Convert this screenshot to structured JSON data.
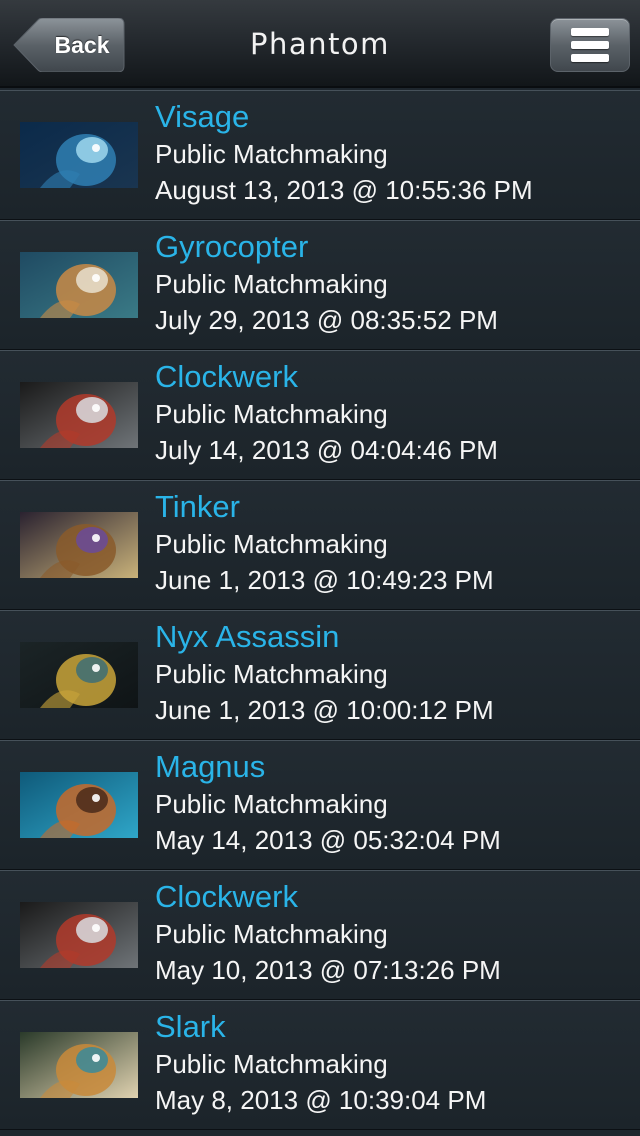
{
  "navbar": {
    "back_label": "Back",
    "title": "Phantom",
    "menu_icon": "hamburger-menu-icon"
  },
  "matches": [
    {
      "hero": "Visage",
      "lobby": "Public Matchmaking",
      "date": "August 13, 2013 @ 10:55:36 PM",
      "portrait": "visage-portrait",
      "palette": [
        "#0b2a4a",
        "#2f7fb3",
        "#9fd8ef",
        "#1a3550"
      ]
    },
    {
      "hero": "Gyrocopter",
      "lobby": "Public Matchmaking",
      "date": "July 29, 2013 @ 08:35:52 PM",
      "portrait": "gyrocopter-portrait",
      "palette": [
        "#1f4a62",
        "#c98a45",
        "#e9e0cf",
        "#3a7a86"
      ]
    },
    {
      "hero": "Clockwerk",
      "lobby": "Public Matchmaking",
      "date": "July 14, 2013 @ 04:04:46 PM",
      "portrait": "clockwerk-portrait",
      "palette": [
        "#1a1a1a",
        "#b23a2a",
        "#d9dde0",
        "#6f7478"
      ]
    },
    {
      "hero": "Tinker",
      "lobby": "Public Matchmaking",
      "date": "June 1, 2013 @ 10:49:23 PM",
      "portrait": "tinker-portrait",
      "palette": [
        "#2a2230",
        "#8a5a2a",
        "#6a4a9a",
        "#c9b27a"
      ]
    },
    {
      "hero": "Nyx Assassin",
      "lobby": "Public Matchmaking",
      "date": "June 1, 2013 @ 10:00:12 PM",
      "portrait": "nyx-assassin-portrait",
      "palette": [
        "#1b2426",
        "#c9a53a",
        "#3d6f75",
        "#0f1416"
      ]
    },
    {
      "hero": "Magnus",
      "lobby": "Public Matchmaking",
      "date": "May 14, 2013 @ 05:32:04 PM",
      "portrait": "magnus-portrait",
      "palette": [
        "#0f5a7a",
        "#c76a2a",
        "#4a2a1a",
        "#2fa6c8"
      ]
    },
    {
      "hero": "Clockwerk",
      "lobby": "Public Matchmaking",
      "date": "May 10, 2013 @ 07:13:26 PM",
      "portrait": "clockwerk-portrait",
      "palette": [
        "#1a1a1a",
        "#b23a2a",
        "#d9dde0",
        "#6f7478"
      ]
    },
    {
      "hero": "Slark",
      "lobby": "Public Matchmaking",
      "date": "May 8, 2013 @ 10:39:04 PM",
      "portrait": "slark-portrait",
      "palette": [
        "#2a3a2a",
        "#c98a3a",
        "#3a8a9a",
        "#e0d2b0"
      ]
    }
  ],
  "colors": {
    "hero_name": "#2ab4e8",
    "row_text": "#f5f5f5",
    "background": "#1e262d"
  }
}
